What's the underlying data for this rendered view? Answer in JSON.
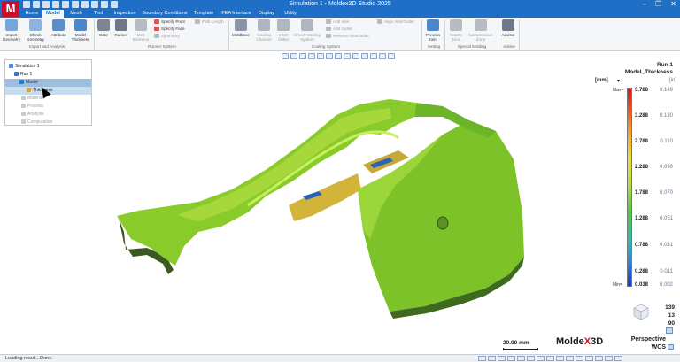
{
  "window": {
    "title": "Simulation 1 - Moldex3D Studio 2025",
    "logo_letter": "M",
    "controls": [
      "–",
      "❐",
      "✕"
    ]
  },
  "tabs": [
    {
      "label": "Home",
      "active": false
    },
    {
      "label": "Model",
      "active": true
    },
    {
      "label": "Mesh",
      "active": false
    },
    {
      "label": "Tool",
      "active": false
    },
    {
      "label": "Inspection",
      "active": false
    },
    {
      "label": "Boundary Conditions",
      "active": false
    },
    {
      "label": "Template",
      "active": false
    },
    {
      "label": "FEA Interface",
      "active": false
    },
    {
      "label": "Display",
      "active": false
    },
    {
      "label": "Utility",
      "active": false
    }
  ],
  "ribbon": {
    "import_geometry": "Import Geometry",
    "check_geometry": "Check Geometry",
    "attribute": "Attribute",
    "model_thickness": "Model Thickness",
    "gate": "Gate",
    "runner": "Runner",
    "melt_entrance": "Melt Entrance",
    "specify_point": "Specify Point",
    "specify_face": "Specify Face",
    "symmetry": "Symmetry",
    "path_length": "Path Length",
    "moldbase": "Moldbase",
    "cooling_channel": "Cooling Channel",
    "inlet_outlet": "Inlet/ Outlet",
    "check_cooling_system": "Check Cooling System",
    "add_inlet": "Add Inlet",
    "add_outlet": "Add Outlet",
    "reverse_inlet_outlet": "Reverse Inlet/Outlet",
    "align_inlet_outlet": "Align Inlet/Outlet",
    "preview_joint": "Preview Joint",
    "nozzle_zone": "Nozzle Zone",
    "compression_zone": "Compression Zone",
    "advisor": "Advisor",
    "groups": {
      "import": "Import and Analysis",
      "runner": "Runner System",
      "cooling": "Cooling System",
      "setting": "Setting",
      "special": "Special Molding",
      "advise": "Advise"
    }
  },
  "tree": {
    "simulation": "Simulation 1",
    "run": "Run 1",
    "model": "Model",
    "thickness": "Thickness",
    "material": "Material",
    "process": "Process",
    "analysis": "Analysis",
    "computation": "Computation"
  },
  "legend": {
    "run": "Run 1",
    "title": "Model_Thickness",
    "unit_left": "[mm]",
    "unit_right": "[in]",
    "max_tag": "Max=",
    "min_tag": "Min=",
    "values_mm": [
      "3.788",
      "3.288",
      "2.788",
      "2.288",
      "1.788",
      "1.288",
      "0.788",
      "0.288",
      "0.038"
    ],
    "values_in": [
      "0.149",
      "0.130",
      "0.110",
      "0.090",
      "0.070",
      "0.051",
      "0.031",
      "0.011",
      "0.002"
    ],
    "colors": [
      "#d4141a",
      "#f7a22b",
      "#e8e037",
      "#b8dc3c",
      "#55c844",
      "#2cc2a5",
      "#2f86e2",
      "#1a35c8"
    ]
  },
  "view": {
    "angles": [
      "139",
      "13",
      "90"
    ],
    "projection": "Perspective",
    "coordinate": "WCS",
    "scale": "20.00 mm"
  },
  "brand": {
    "prefix": "Molde",
    "accent": "X",
    "suffix": "3D"
  },
  "status": {
    "text": "Loading result...Done."
  },
  "colors": {
    "title_blue": "#1f6fc6",
    "model_green": "#7dc62c",
    "model_yellow": "#c9b93a",
    "brand_red": "#c8102e"
  }
}
